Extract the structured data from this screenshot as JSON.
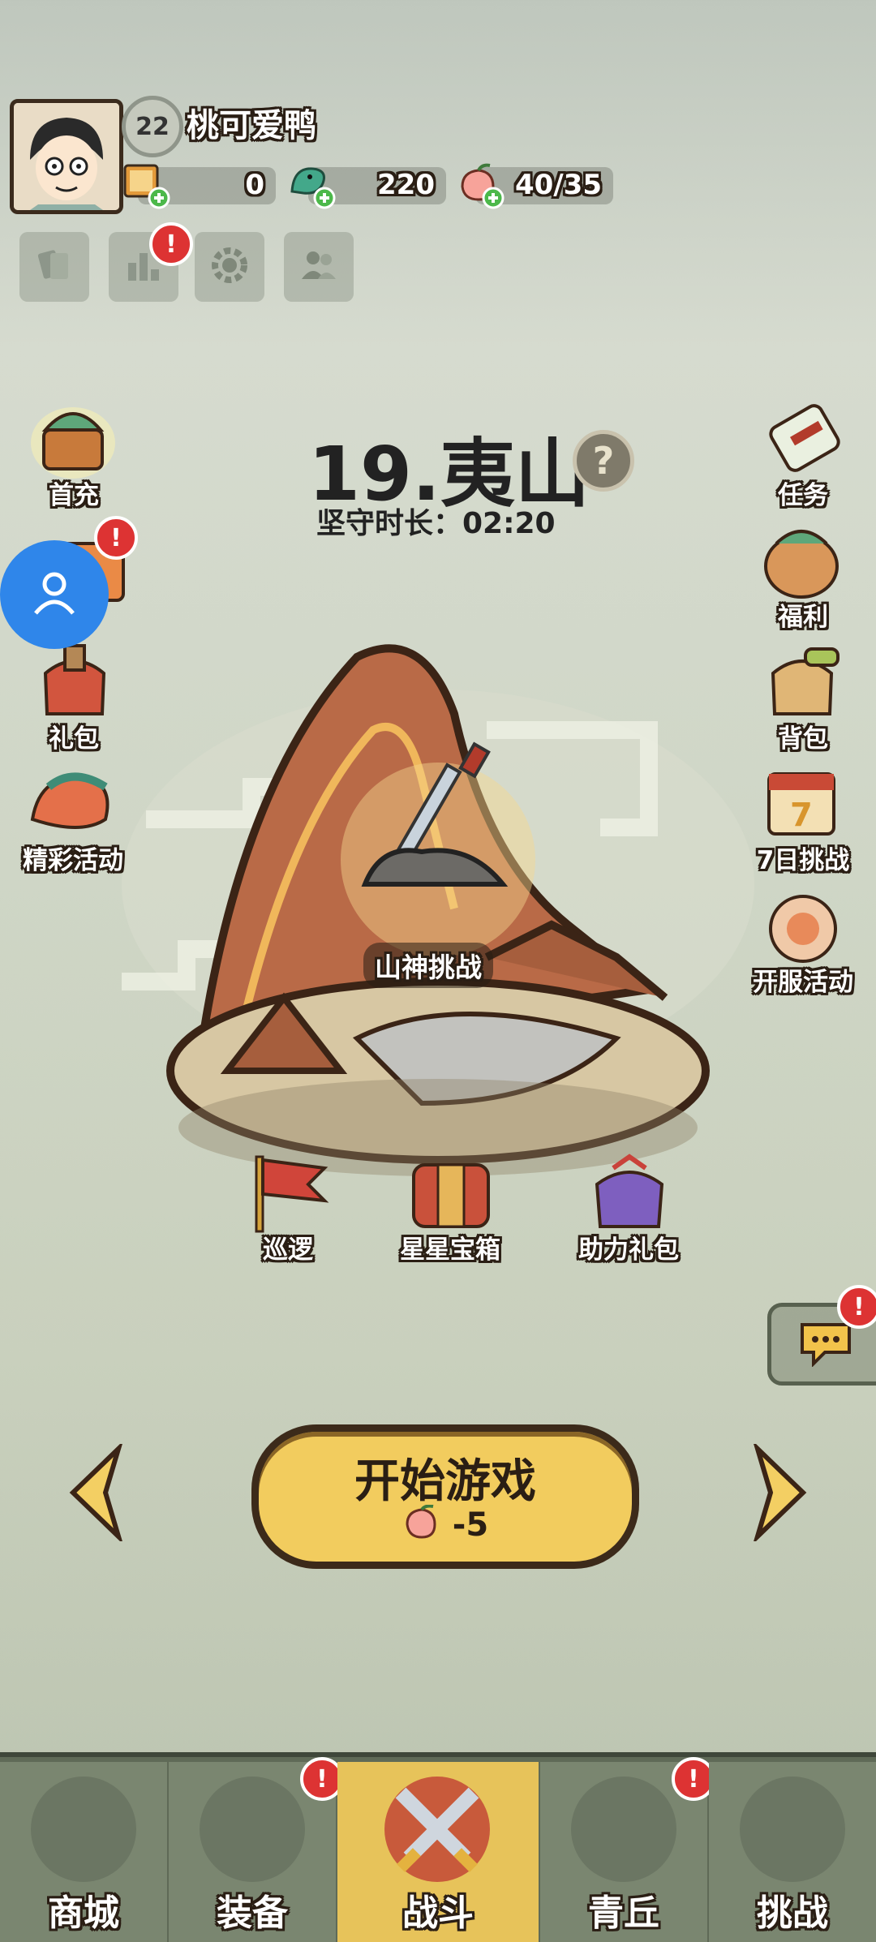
{
  "player": {
    "level": "22",
    "name": "桃可爱鸭"
  },
  "resources": [
    {
      "icon": "ticket-icon",
      "value": "0"
    },
    {
      "icon": "jade-dragon-icon",
      "value": "220"
    },
    {
      "icon": "peach-icon",
      "value": "40/35"
    }
  ],
  "toolbar": [
    {
      "icon": "cards-icon"
    },
    {
      "icon": "ranking-icon",
      "alert": "!"
    },
    {
      "icon": "settings-icon"
    },
    {
      "icon": "friends-icon"
    }
  ],
  "stage": {
    "title": "19.夷山",
    "help": "?",
    "duration": "坚守时长：02:20",
    "challenge": "山神挑战"
  },
  "left_menu": [
    {
      "label": "首充"
    },
    {
      "label": "",
      "alert": "!"
    },
    {
      "label": "礼包"
    },
    {
      "label": "精彩活动"
    }
  ],
  "right_menu": [
    {
      "label": "任务"
    },
    {
      "label": "福利"
    },
    {
      "label": "背包"
    },
    {
      "label": "7日挑战"
    },
    {
      "label": "开服活动"
    }
  ],
  "stage_buttons": [
    {
      "label": "巡逻"
    },
    {
      "label": "星星宝箱"
    },
    {
      "label": "助力礼包"
    }
  ],
  "chat": {
    "alert": "!"
  },
  "start": {
    "label": "开始游戏",
    "cost": "-5"
  },
  "nav": [
    {
      "label": "商城"
    },
    {
      "label": "装备",
      "alert": "!"
    },
    {
      "label": "战斗",
      "active": true
    },
    {
      "label": "青丘",
      "alert": "!"
    },
    {
      "label": "挑战"
    }
  ]
}
